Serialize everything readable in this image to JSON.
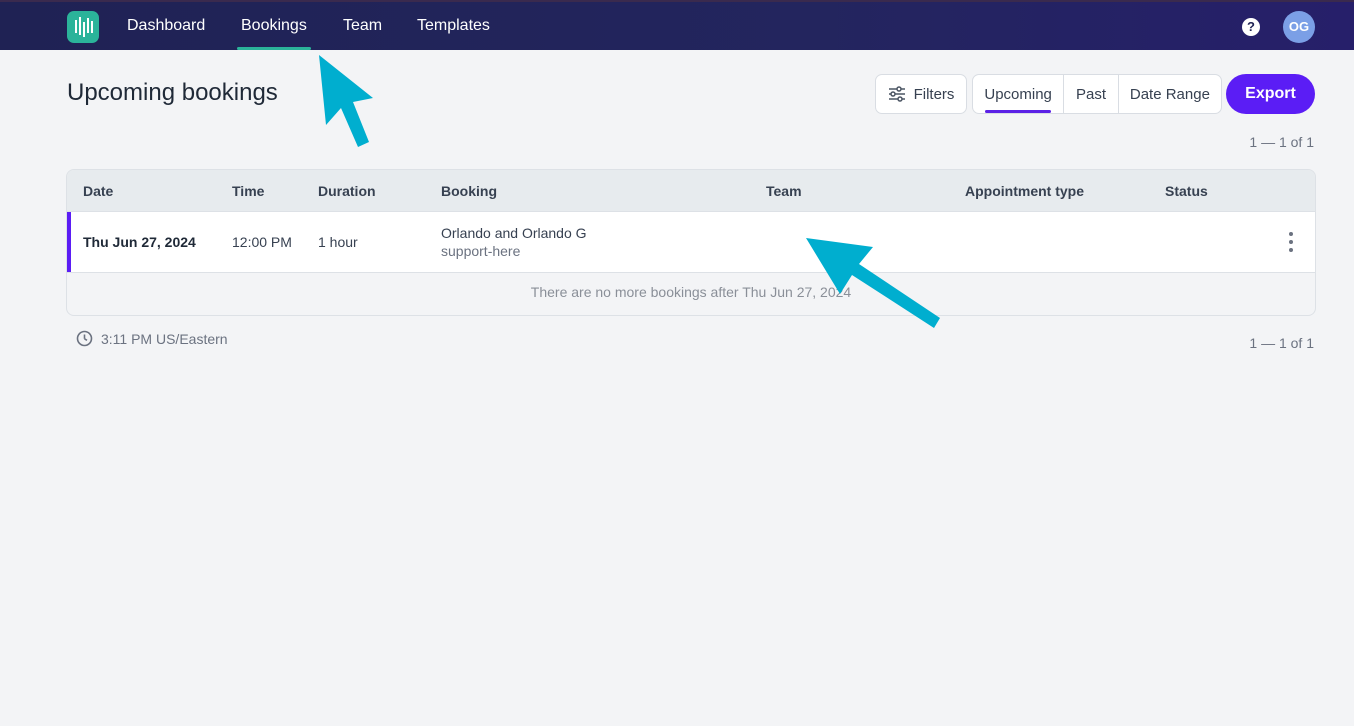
{
  "nav": {
    "items": [
      {
        "label": "Dashboard",
        "active": false
      },
      {
        "label": "Bookings",
        "active": true
      },
      {
        "label": "Team",
        "active": false
      },
      {
        "label": "Templates",
        "active": false
      }
    ],
    "help_symbol": "?",
    "avatar_initials": "OG"
  },
  "header": {
    "title": "Upcoming bookings",
    "filters_label": "Filters",
    "segments": [
      "Upcoming",
      "Past",
      "Date Range"
    ],
    "active_segment": "Upcoming",
    "export_label": "Export"
  },
  "pagination": {
    "top": "1 — 1 of 1",
    "bottom": "1 — 1 of 1"
  },
  "table": {
    "columns": [
      "Date",
      "Time",
      "Duration",
      "Booking",
      "Team",
      "Appointment type",
      "Status"
    ],
    "rows": [
      {
        "date": "Thu Jun 27, 2024",
        "time": "12:00 PM",
        "duration": "1 hour",
        "booking_title": "Orlando and Orlando G",
        "booking_subtitle": "support-here",
        "team": "",
        "appointment_type": "",
        "status": ""
      }
    ],
    "footer_note": "There are no more bookings after Thu Jun 27, 2024"
  },
  "timezone": "3:11 PM US/Eastern",
  "colors": {
    "nav_bg": "#23255e",
    "accent_teal": "#2bb39a",
    "accent_purple": "#5b1df5",
    "annotation_arrow": "#00aecf"
  },
  "icons": [
    "app-logo-icon",
    "help-icon",
    "filters-sliders-icon",
    "more-vertical-icon",
    "clock-icon"
  ]
}
